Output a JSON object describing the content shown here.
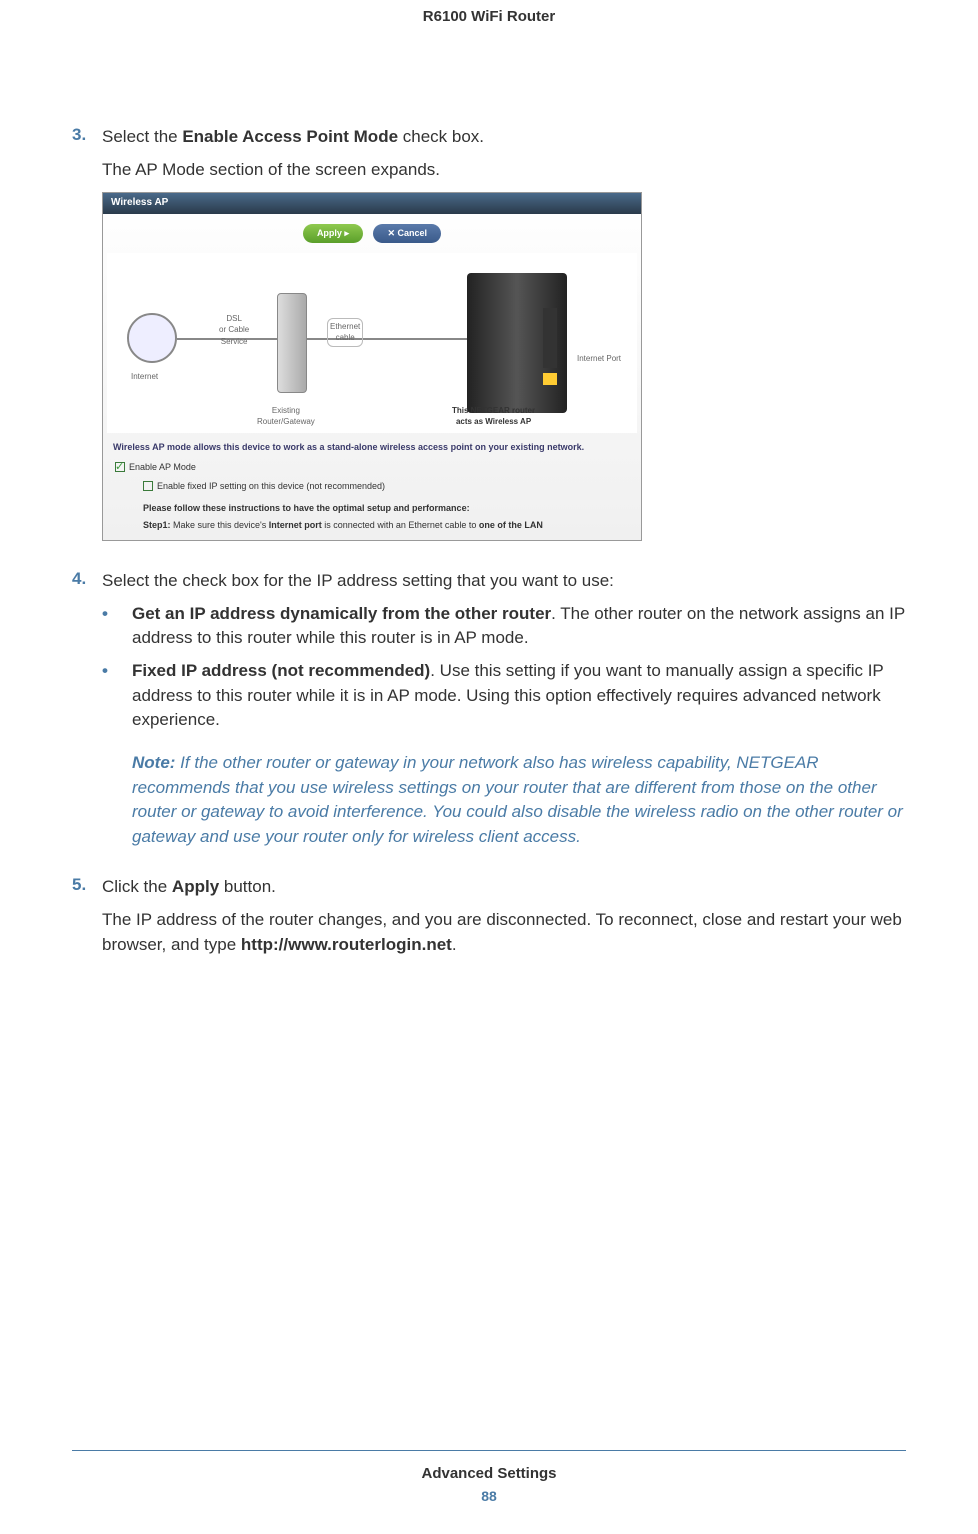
{
  "header": {
    "title": "R6100 WiFi Router"
  },
  "footer": {
    "section": "Advanced Settings",
    "page": "88"
  },
  "steps": {
    "s3": {
      "num": "3.",
      "line1_a": "Select the ",
      "line1_b": "Enable Access Point Mode",
      "line1_c": " check box.",
      "line2": "The AP Mode section of the screen expands."
    },
    "s4": {
      "num": "4.",
      "line1": "Select the check box for the IP address setting that you want to use:",
      "bullet1_b": "Get an IP address dynamically from the other router",
      "bullet1_t": ". The other router on the network assigns an IP address to this router while this router is in AP mode.",
      "bullet2_b": "Fixed IP address (not recommended)",
      "bullet2_t": ". Use this setting if you want to manually assign a specific IP address to this router while it is in AP mode. Using this option effectively requires advanced network experience.",
      "note_label": "Note:  ",
      "note_text": "If the other router or gateway in your network also has wireless capability, NETGEAR recommends that you use wireless settings on your router that are different from those on the other router or gateway to avoid interference. You could also disable the wireless radio on the other router or gateway and use your router only for wireless client access."
    },
    "s5": {
      "num": "5.",
      "line1_a": "Click the ",
      "line1_b": "Apply",
      "line1_c": " button.",
      "line2_a": "The IP address of the router changes, and you are disconnected. To reconnect, close and restart your web browser, and type ",
      "line2_b": "http://www.routerlogin.net",
      "line2_c": "."
    }
  },
  "screenshot": {
    "title": "Wireless AP",
    "apply": "Apply ▸",
    "cancel": "✕ Cancel",
    "internet_label": "Internet",
    "dsl_label": "DSL\nor Cable\nService",
    "eth_label": "Ethernet\ncable",
    "iport_label": "Internet Port",
    "cap1": "Existing\nRouter/Gateway",
    "cap2": "This NETGEAR router\nacts as Wireless AP",
    "desc": "Wireless AP mode allows this device to work as a stand-alone wireless access point on your existing network.",
    "check1": "Enable AP Mode",
    "check2": "Enable fixed IP setting on this device (not recommended)",
    "instr": "Please follow these instructions to have the optimal setup and performance:",
    "step1_lbl": "Step1: ",
    "step1_a": "Make sure this device's ",
    "step1_b": "Internet port",
    "step1_c": " is connected with an Ethernet cable to ",
    "step1_d": "one of the LAN"
  }
}
